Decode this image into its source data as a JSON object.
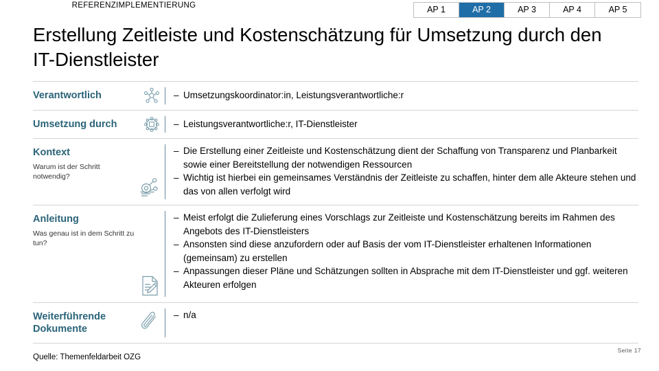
{
  "header": {
    "kicker": "REFERENZIMPLEMENTIERUNG",
    "tabs": [
      {
        "label": "AP 1",
        "active": false
      },
      {
        "label": "AP 2",
        "active": true
      },
      {
        "label": "AP 3",
        "active": false
      },
      {
        "label": "AP 4",
        "active": false
      },
      {
        "label": "AP 5",
        "active": false
      }
    ],
    "accent_color": "#1f6ea8",
    "label_color": "#2a6378"
  },
  "title": "Erstellung Zeitleiste und Kostenschätzung für Umsetzung durch den IT-Dienstleister",
  "rows": {
    "verantwortlich": {
      "label": "Verantwortlich",
      "icon": "people-network-icon",
      "bullets": [
        "Umsetzungskoordinator:in, Leistungsverantwortliche:r"
      ]
    },
    "umsetzung": {
      "label": "Umsetzung durch",
      "icon": "gear-people-icon",
      "bullets": [
        "Leistungsverantwortliche:r, IT-Dienstleister"
      ]
    },
    "kontext": {
      "label": "Kontext",
      "sublabel": "Warum ist der Schritt notwendig?",
      "icon": "magnifier-analysis-icon",
      "bullets": [
        "Die Erstellung einer Zeitleiste und Kostenschätzung dient der Schaffung von Transparenz und Planbarkeit sowie einer Bereitstellung der notwendigen Ressourcen",
        "Wichtig ist hierbei ein gemeinsames Verständnis der Zeitleiste zu schaffen, hinter dem alle Akteure stehen und das von allen verfolgt wird"
      ]
    },
    "anleitung": {
      "label": "Anleitung",
      "sublabel": "Was genau ist in dem Schritt zu tun?",
      "icon": "document-pencil-icon",
      "bullets": [
        "Meist erfolgt die Zulieferung eines Vorschlags zur Zeitleiste und Kostenschätzung bereits im Rahmen des Angebots des IT-Dienstleisters",
        "Ansonsten sind diese anzufordern oder auf Basis der vom IT-Dienstleister erhaltenen Informationen (gemeinsam) zu erstellen",
        "Anpassungen dieser Pläne und Schätzungen sollten in Absprache mit dem IT-Dienstleister und ggf. weiteren Akteuren erfolgen"
      ]
    },
    "dokumente": {
      "label": "Weiterführende Dokumente",
      "icon": "paperclip-icon",
      "bullets": [
        "n/a"
      ]
    }
  },
  "footer": {
    "source": "Quelle: Themenfeldarbeit OZG",
    "page": "Seite 17"
  },
  "bullet_dash": "–"
}
